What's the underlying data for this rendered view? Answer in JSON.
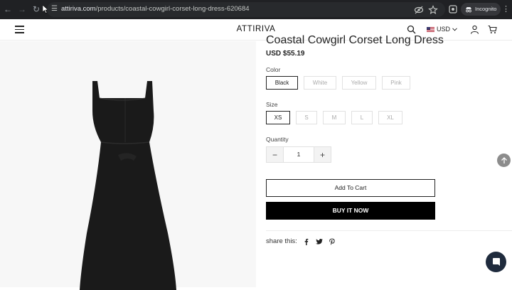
{
  "browser": {
    "url_domain": "attiriva.com",
    "url_path": "/products/coastal-cowgirl-corset-long-dress-620684",
    "incognito_label": "Incognito"
  },
  "header": {
    "logo": "ATTIRIVA",
    "currency": "USD"
  },
  "product": {
    "title": "Coastal Cowgirl Corset Long Dress",
    "price": "USD $55.19",
    "color_label": "Color",
    "colors": [
      "Black",
      "White",
      "Yellow",
      "Pink"
    ],
    "selected_color": "Black",
    "size_label": "Size",
    "sizes": [
      "XS",
      "S",
      "M",
      "L",
      "XL"
    ],
    "selected_size": "XS",
    "quantity_label": "Quantity",
    "quantity": "1",
    "qty_minus": "−",
    "qty_plus": "+",
    "add_to_cart": "Add To Cart",
    "buy_now": "BUY IT NOW",
    "share_label": "share this:"
  },
  "colors": {
    "chrome_bg": "#202124",
    "buy_now_bg": "#000000",
    "chat_bg": "#1f2b3d",
    "dress": "#1a1a1a"
  },
  "icons": [
    "back-icon",
    "forward-icon",
    "reload-icon",
    "site-info-icon",
    "eye-off-icon",
    "star-icon",
    "extension-icon",
    "incognito-icon",
    "menu-icon",
    "search-icon",
    "user-icon",
    "cart-icon",
    "facebook-icon",
    "twitter-icon",
    "pinterest-icon",
    "arrow-up-icon",
    "chat-icon"
  ]
}
